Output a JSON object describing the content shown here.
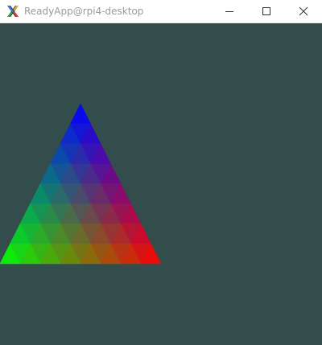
{
  "window": {
    "title": "ReadyApp@rpi4-desktop",
    "app_icon": "x-window-system-icon",
    "controls": {
      "minimize_icon": "minimize-icon",
      "maximize_icon": "maximize-icon",
      "close_icon": "close-icon"
    }
  },
  "scene": {
    "background_color": "#334c4c",
    "shape": "triangle",
    "vertex_colors": {
      "top": "#0000ff",
      "bottom_left": "#00ff00",
      "bottom_right": "#ff0000"
    },
    "subdivisions": 8
  }
}
